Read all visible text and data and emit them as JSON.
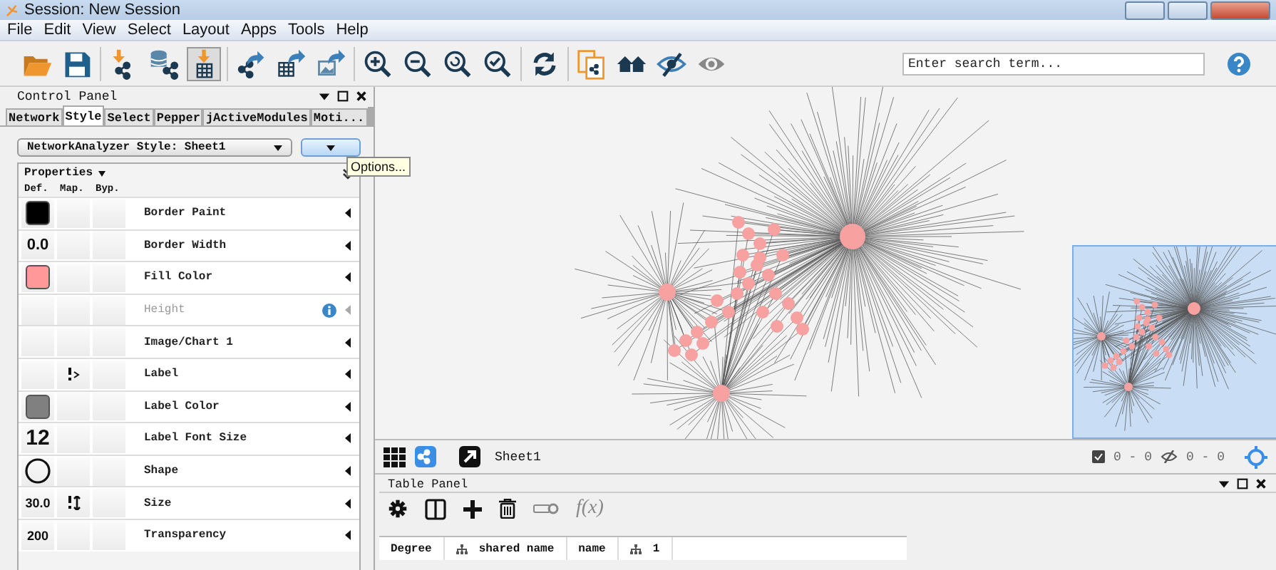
{
  "window": {
    "title": "Session: New Session"
  },
  "menu": [
    "File",
    "Edit",
    "View",
    "Select",
    "Layout",
    "Apps",
    "Tools",
    "Help"
  ],
  "toolbar": [
    [
      {
        "kind": "folder",
        "pressed": false
      },
      {
        "kind": "save",
        "pressed": false
      }
    ],
    [
      {
        "kind": "arrow-network",
        "pressed": false
      },
      {
        "kind": "database-network",
        "pressed": false
      },
      {
        "kind": "arrow-table",
        "pressed": true
      }
    ],
    [
      {
        "kind": "network-arrow",
        "pressed": false
      },
      {
        "kind": "table-arrow",
        "pressed": false
      },
      {
        "kind": "image-arrow",
        "pressed": false
      }
    ],
    [
      {
        "kind": "zoom-in",
        "pressed": false
      },
      {
        "kind": "zoom-out",
        "pressed": false
      },
      {
        "kind": "zoom-fit",
        "pressed": false
      },
      {
        "kind": "zoom-check",
        "pressed": false
      }
    ],
    [
      {
        "kind": "refresh",
        "pressed": false
      }
    ],
    [
      {
        "kind": "document-network",
        "pressed": false
      },
      {
        "kind": "houses",
        "pressed": false
      },
      {
        "kind": "eye-slash",
        "pressed": false
      },
      {
        "kind": "eye",
        "pressed": false
      }
    ]
  ],
  "search": {
    "placeholder": "Enter search term..."
  },
  "control_panel": {
    "title": "Control Panel",
    "tabs": [
      {
        "label": "Network",
        "selected": false
      },
      {
        "label": "Style",
        "selected": true
      },
      {
        "label": "Select",
        "selected": false
      },
      {
        "label": "Pepper",
        "selected": false
      },
      {
        "label": "jActiveModules",
        "selected": false
      },
      {
        "label": "Moti...",
        "selected": false
      }
    ],
    "style_name": "NetworkAnalyzer Style: Sheet1",
    "tooltip": "Options...",
    "properties_label": "Properties",
    "columns": [
      "Def.",
      "Map.",
      "Byp."
    ],
    "rows": [
      {
        "label": "Border Paint",
        "default": {
          "kind": "color",
          "color": "#000000"
        },
        "mapping": {
          "kind": "none"
        },
        "disabled": false
      },
      {
        "label": "Border Width",
        "default": {
          "kind": "text",
          "text": "0.0"
        },
        "mapping": {
          "kind": "none"
        },
        "disabled": false
      },
      {
        "label": "Fill Color",
        "default": {
          "kind": "color",
          "color": "#ff9999"
        },
        "mapping": {
          "kind": "none"
        },
        "disabled": false
      },
      {
        "label": "Height",
        "default": {
          "kind": "none"
        },
        "mapping": {
          "kind": "none"
        },
        "disabled": true
      },
      {
        "label": "Image/Chart 1",
        "default": {
          "kind": "none"
        },
        "mapping": {
          "kind": "none"
        },
        "disabled": false
      },
      {
        "label": "Label",
        "default": {
          "kind": "none"
        },
        "mapping": {
          "kind": "passthrough"
        },
        "disabled": false
      },
      {
        "label": "Label Color",
        "default": {
          "kind": "color",
          "color": "#808080"
        },
        "mapping": {
          "kind": "none"
        },
        "disabled": false
      },
      {
        "label": "Label Font Size",
        "default": {
          "kind": "large_text",
          "text": "12"
        },
        "mapping": {
          "kind": "none"
        },
        "disabled": false
      },
      {
        "label": "Shape",
        "default": {
          "kind": "circle"
        },
        "mapping": {
          "kind": "none"
        },
        "disabled": false
      },
      {
        "label": "Size",
        "default": {
          "kind": "small_text",
          "text": "30.0"
        },
        "mapping": {
          "kind": "continuous"
        },
        "disabled": false
      },
      {
        "label": "Transparency",
        "default": {
          "kind": "small_text",
          "text": "200"
        },
        "mapping": {
          "kind": "none"
        },
        "disabled": false
      }
    ]
  },
  "network_view": {
    "sheet": "Sheet1",
    "selected_count": "0 - 0",
    "hidden_count": "0 - 0"
  },
  "table_panel": {
    "title": "Table Panel",
    "function_label": "f(x)",
    "columns": [
      {
        "label": "Degree",
        "namespace_icon": false
      },
      {
        "label": "shared name",
        "namespace_icon": true
      },
      {
        "label": "name",
        "namespace_icon": false
      },
      {
        "label": "1",
        "namespace_icon": true
      }
    ]
  }
}
